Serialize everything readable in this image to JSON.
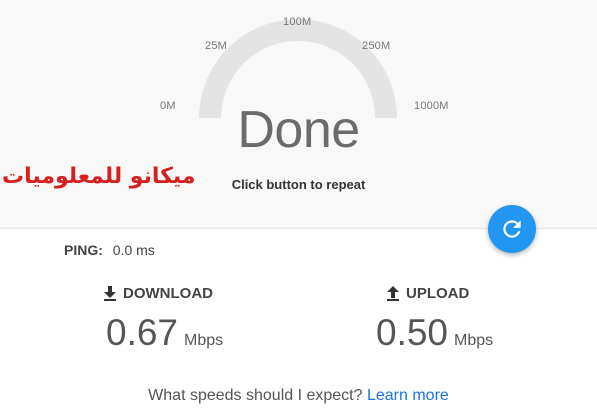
{
  "gauge": {
    "ticks": [
      "0M",
      "25M",
      "100M",
      "250M",
      "1000M"
    ],
    "status": "Done",
    "hint": "Click button to repeat"
  },
  "watermark": "ميكانو للمعلوميات",
  "repeat_button": {
    "icon": "refresh-icon",
    "color": "#2196f3"
  },
  "ping": {
    "label": "PING:",
    "value": "0.0 ms"
  },
  "download": {
    "label": "DOWNLOAD",
    "value": "0.67",
    "unit": "Mbps",
    "icon": "download-icon"
  },
  "upload": {
    "label": "UPLOAD",
    "value": "0.50",
    "unit": "Mbps",
    "icon": "upload-icon"
  },
  "footer": {
    "question": "What speeds should I expect?",
    "link": "Learn more"
  },
  "colors": {
    "accent": "#2196f3",
    "link": "#1a73e8",
    "watermark": "#d61f1f"
  }
}
